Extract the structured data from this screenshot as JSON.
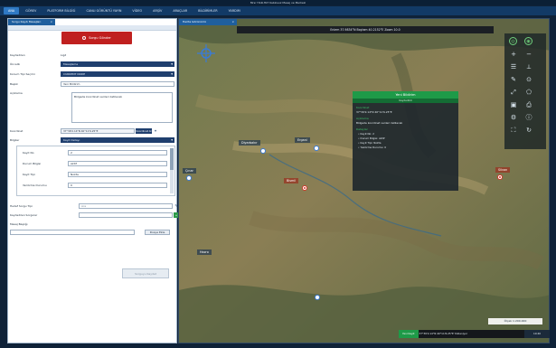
{
  "window": {
    "title": "Mrsr HAR-HLT Kablosuz Mesaj ve Merkezi"
  },
  "menu": {
    "tabs": [
      "ANA",
      "GÖREV",
      "PLATFORM BİLGİSİ",
      "CANLI GÖRÜNTÜ YAYIN",
      "VİDEO",
      "ARŞİV",
      "ARAÇLAR",
      "BİLDİRİMLER",
      "YARDIM"
    ]
  },
  "left_panel": {
    "tab_label": "Sorgu Kaydı Mesajları",
    "stop_button": "Sorgu Gönder",
    "fields": [
      {
        "label": "Kaydedilen",
        "value": "Ligd"
      },
      {
        "label": "Öncelik",
        "value": "Mesajlama"
      },
      {
        "label": "Konum Tipi Seçimi",
        "value": "CURRENT NODE"
      },
      {
        "label": "Başlık",
        "value": "Yeni Bildirim"
      }
    ],
    "description_label": "Açıklama",
    "description": "Bölgede koordinat verileri iletilecek",
    "coord_label": "Koordinat",
    "coord_value": "37°39'2.14\"N 40°11'6.25\"E",
    "coord_button": "Koordinat Al",
    "info_label": "Bilgiler",
    "info_value": "Kayıt Detayı",
    "layer_rows": [
      {
        "label": "Kayıt No",
        "value": "2"
      },
      {
        "label": "Durum Bilgisi",
        "value": "Aktif"
      },
      {
        "label": "Kayıt Tipi",
        "value": "Nokta"
      },
      {
        "label": "Yazdırma Durumu",
        "value": "0"
      }
    ],
    "hedef_label": "Hedef Sorgu Tipi",
    "hedef_placeholder": "Ara",
    "kaydet_label": "Kaydedilen Sorgular",
    "mesaj_label": "Mesaj Başlığı",
    "browse_button": "Dosya Ekle",
    "save_button": "Sorguyu Kaydet"
  },
  "map": {
    "tab_label": "Harita Görünümü",
    "coord_bar": "Enlem 37.9834°N  Boylam 40.2152°E  Zoom 10.0",
    "labels": [
      {
        "text": "Diyarbakır",
        "red": false
      },
      {
        "text": "Ergani",
        "red": false
      },
      {
        "text": "Çınar",
        "red": false
      },
      {
        "text": "Bismil",
        "red": true
      },
      {
        "text": "Silvan",
        "red": true
      },
      {
        "text": "Hazro",
        "red": false
      }
    ],
    "popup": {
      "title": "Yeni Bildirim",
      "subtitle": "Kaydedildi",
      "heading1": "Koordinat",
      "coord_text": "37°39'2.14\"N 40°11'6.25\"E",
      "heading2": "Açıklama",
      "desc_text": "Bölgede koordinat verileri iletilecek",
      "heading3": "Detaylar",
      "items": [
        "Kayıt No: 2",
        "Durum Bilgisi: Aktif",
        "Kayıt Tipi: Nokta",
        "Yazdırma Durumu: 0"
      ]
    },
    "scale_label": "Ölçek 1:200.000",
    "bottom_bar": {
      "button": "Yeni Kayıt",
      "text": "37°39'2.14\"N 40°11'6.25\"E Yükleniyor",
      "tri": "10:40"
    }
  },
  "colors": {
    "accent": "#2f79c4",
    "stop": "#c0201f",
    "popup_header": "#1e9a48",
    "pin_blue": "#3a7bd5",
    "pin_red": "#d23a2a"
  },
  "icons": {
    "toolbar": [
      "compass-icon",
      "zoom-in-icon",
      "zoom-out-icon",
      "layers-icon",
      "ruler-icon",
      "draw-icon",
      "pin-icon",
      "measure-icon",
      "settings-icon"
    ]
  }
}
